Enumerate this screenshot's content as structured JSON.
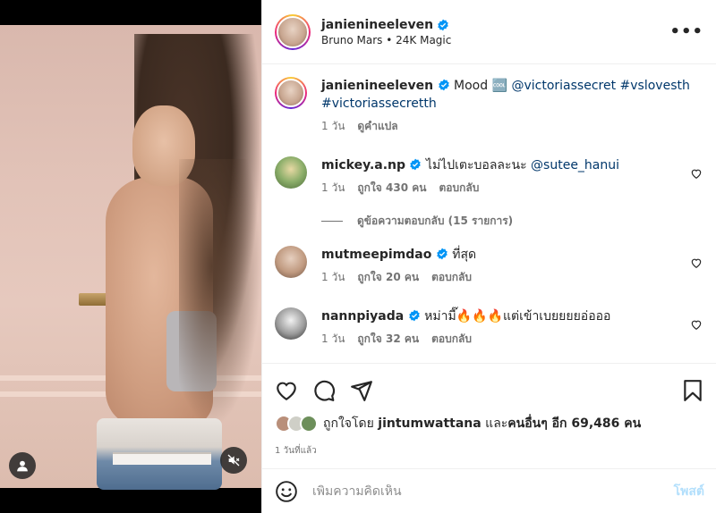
{
  "header": {
    "username": "janienineeleven",
    "audio": "Bruno Mars • 24K Magic",
    "more_label": "•••"
  },
  "caption": {
    "username": "janienineeleven",
    "text": "Mood 🆒",
    "mention": "@victoriassecret",
    "tags1": "#vslovesth",
    "tags2": "#victoriassecretth",
    "time": "1 วัน",
    "translate": "ดูคำแปล"
  },
  "comments": [
    {
      "username": "mickey.a.np",
      "text": "ไม่ไปเตะบอลละนะ",
      "mention": "@sutee_hanui",
      "time": "1 วัน",
      "likes": "ถูกใจ 430 คน",
      "reply": "ตอบกลับ",
      "replies_label": "ดูข้อความตอบกลับ (15 รายการ)"
    },
    {
      "username": "mutmeepimdao",
      "text": "ที่สุด",
      "time": "1 วัน",
      "likes": "ถูกใจ 20 คน",
      "reply": "ตอบกลับ"
    },
    {
      "username": "nannpiyada",
      "text": "หม่ามี๊🔥🔥🔥แต่เข้าเบยยยยอ่อออ",
      "time": "1 วัน",
      "likes": "ถูกใจ 32 คน",
      "reply": "ตอบกลับ"
    }
  ],
  "likes": {
    "prefix": "ถูกใจโดย",
    "user": "jintumwattana",
    "middle": "และ",
    "others": "คนอื่นๆ อีก 69,486 คน"
  },
  "posted_time": "1 วันที่แล้ว",
  "add_comment": {
    "placeholder": "เพิ่มความคิดเห็น",
    "post_label": "โพสต์"
  },
  "icons": {
    "verified": "verified-badge-icon",
    "heart": "heart-icon",
    "comment": "comment-icon",
    "share": "share-icon",
    "save": "bookmark-icon",
    "emoji": "emoji-icon",
    "user": "user-tag-icon",
    "mute": "muted-speaker-icon"
  },
  "colors": {
    "link": "#00376b",
    "verified": "#0095f6",
    "muted_text": "#737373",
    "post_button": "#b2dffc"
  }
}
